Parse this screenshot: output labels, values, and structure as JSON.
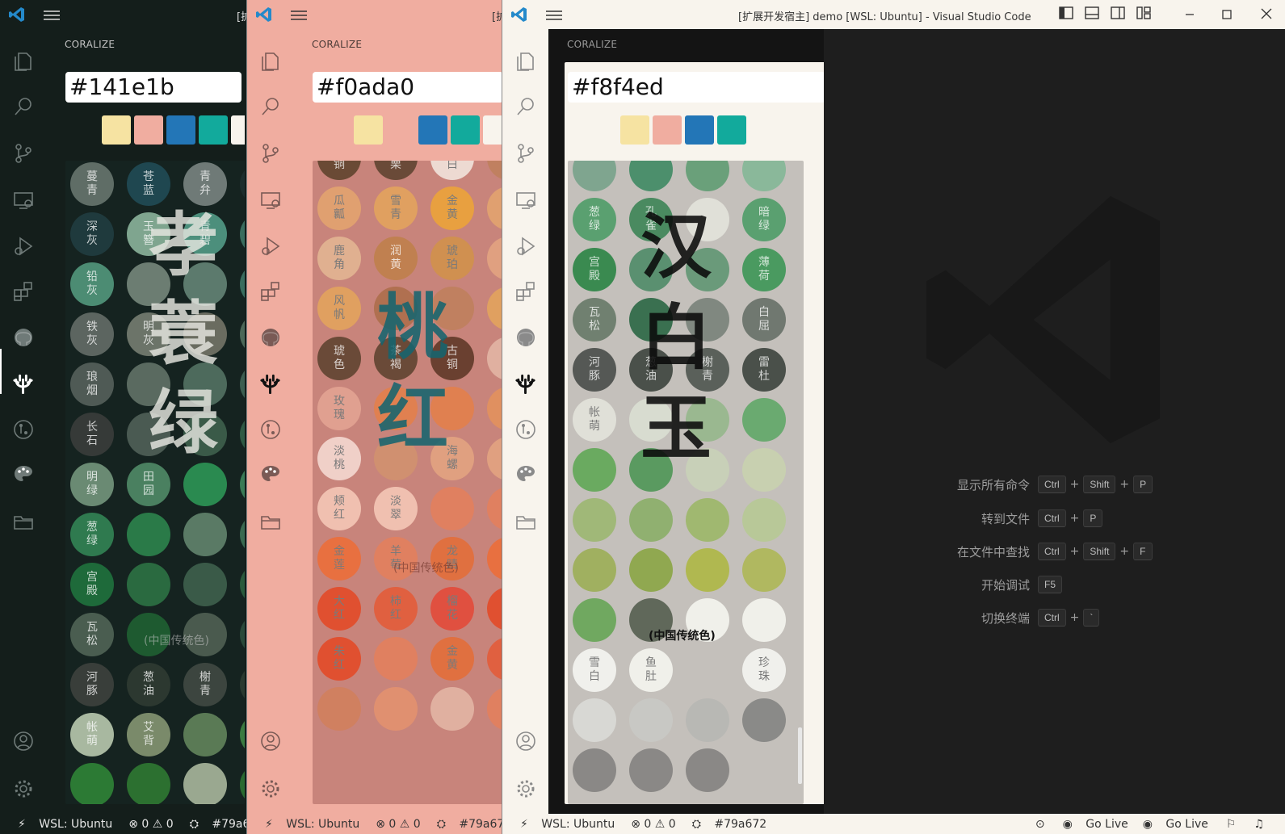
{
  "windows": [
    {
      "id": "w1",
      "title": "[扩",
      "sidebar_title": "CORALIZE",
      "hex": "#141e1b",
      "theme": {
        "titlebar": "#141e1b",
        "activity": "#141e1b",
        "sidebar": "#141e1b",
        "panel": "#141e1b",
        "text": "#ffffff",
        "header": "#c5c5c5",
        "grid": "#152320",
        "icon": "#6f7a78",
        "status": "#141e1b",
        "status_text": "#e6e6e6"
      },
      "swatches": [
        "#f6e3a2",
        "#f0ada0",
        "#2376b7",
        "#12aa9c",
        "#f8f4ed"
      ],
      "calli": "孝\n蓑\n绿",
      "calli_sub": "(中国传统色)",
      "dots": [
        {
          "l": "蔓\n青",
          "c": "#5f6d66"
        },
        {
          "l": "苍\n蓝",
          "c": "#1f4750"
        },
        {
          "l": "青\n弁",
          "c": "#6f7a77"
        },
        {
          "l": "",
          "c": "#1c2e2d"
        },
        {
          "l": "深\n灰",
          "c": "#1f3a3d"
        },
        {
          "l": "玉\n簪",
          "c": "#7fa58f"
        },
        {
          "l": "青\n碧",
          "c": "#4c8f7c"
        },
        {
          "l": "",
          "c": "#3a6d5e"
        },
        {
          "l": "铅\n灰",
          "c": "#4c8c73"
        },
        {
          "l": "",
          "c": "#6c7d72"
        },
        {
          "l": "",
          "c": "#5c7a6d"
        },
        {
          "l": "",
          "c": "#3a6d5e"
        },
        {
          "l": "铁\n灰",
          "c": "#5c6560"
        },
        {
          "l": "明\n灰",
          "c": "#6c7469"
        },
        {
          "l": "",
          "c": "#6a6c60"
        },
        {
          "l": "",
          "c": "#4c6858"
        },
        {
          "l": "琅\n烟",
          "c": "#4f5a55"
        },
        {
          "l": "",
          "c": "#5a6a60"
        },
        {
          "l": "",
          "c": "#4d6a5c"
        },
        {
          "l": "",
          "c": "#3c5e50"
        },
        {
          "l": "长\n石",
          "c": "#363a38"
        },
        {
          "l": "",
          "c": "#4a5a52"
        },
        {
          "l": "",
          "c": "#3a5a48"
        },
        {
          "l": "",
          "c": "#2f5a44"
        },
        {
          "l": "明\n绿",
          "c": "#6a8a73"
        },
        {
          "l": "田\n园",
          "c": "#4a8060"
        },
        {
          "l": "",
          "c": "#2a8a50"
        },
        {
          "l": "",
          "c": "#3a7a55"
        },
        {
          "l": "葱\n绿",
          "c": "#2f7a4f"
        },
        {
          "l": "",
          "c": "#2a7a48"
        },
        {
          "l": "",
          "c": "#5a7a65"
        },
        {
          "l": "",
          "c": "#3a6a50"
        },
        {
          "l": "宫\n殿",
          "c": "#1e6a3a"
        },
        {
          "l": "",
          "c": "#2a6a40"
        },
        {
          "l": "",
          "c": "#3a5a48"
        },
        {
          "l": "",
          "c": "#2a5a3c"
        },
        {
          "l": "瓦\n松",
          "c": "#4a5d50"
        },
        {
          "l": "",
          "c": "#1e5a30"
        },
        {
          "l": "",
          "c": "#4a5a4e"
        },
        {
          "l": "",
          "c": "#2a4a3a"
        },
        {
          "l": "河\n豚",
          "c": "#393e3a"
        },
        {
          "l": "葱\n油",
          "c": "#2c3830"
        },
        {
          "l": "榭\n青",
          "c": "#3c453f"
        },
        {
          "l": "",
          "c": "#2a3a30"
        },
        {
          "l": "帐\n萌",
          "c": "#a8b8a0"
        },
        {
          "l": "艾\n背",
          "c": "#7a8a6a"
        },
        {
          "l": "",
          "c": "#5a7a55"
        },
        {
          "l": "",
          "c": "#3a7a40"
        },
        {
          "l": "",
          "c": "#2c7a34"
        },
        {
          "l": "",
          "c": "#2c7030"
        },
        {
          "l": "",
          "c": "#9aa890"
        },
        {
          "l": "",
          "c": "#2a6a30"
        }
      ],
      "status": {
        "wsl": "WSL: Ubuntu",
        "problems": "⊗ 0 ⚠ 0",
        "branch": "#79a672"
      }
    },
    {
      "id": "w2",
      "title": "[扩",
      "sidebar_title": "CORALIZE",
      "hex": "#f0ada0",
      "theme": {
        "titlebar": "#f0ada0",
        "activity": "#f0ada0",
        "sidebar": "#f0ada0",
        "panel": "#f0ada0",
        "text": "#111111",
        "header": "#4a3a36",
        "grid": "#c8847b",
        "icon": "#7a5a55",
        "status": "#f0ada0",
        "status_text": "#333333"
      },
      "swatches": [
        "#f6e3a2",
        "#f0ada0",
        "#2376b7",
        "#12aa9c",
        "#f8f4ed"
      ],
      "calli": "桃\n红",
      "calli_sub": "(中国传统色)",
      "dots": [
        {
          "l": "古\n铜",
          "c": "#6a4a35"
        },
        {
          "l": "马\n栗",
          "c": "#6a4a38"
        },
        {
          "l": "粉\n白",
          "c": "#eddad2"
        },
        {
          "l": "",
          "c": "#c08060"
        },
        {
          "l": "瓜\n瓤",
          "c": "#e0a070"
        },
        {
          "l": "雪\n青",
          "c": "#e0a060"
        },
        {
          "l": "金\n黄",
          "c": "#e8a040"
        },
        {
          "l": "",
          "c": "#e0a070"
        },
        {
          "l": "鹿\n角",
          "c": "#e0b090"
        },
        {
          "l": "润\n黄",
          "c": "#c08050"
        },
        {
          "l": "琥\n珀",
          "c": "#d09050"
        },
        {
          "l": "",
          "c": "#e0a080"
        },
        {
          "l": "风\n帆",
          "c": "#e0a060"
        },
        {
          "l": "",
          "c": "#b07050"
        },
        {
          "l": "",
          "c": "#c08060"
        },
        {
          "l": "",
          "c": "#e0a060"
        },
        {
          "l": "琥\n色",
          "c": "#6a4a38"
        },
        {
          "l": "茶\n褐",
          "c": "#6a4a38"
        },
        {
          "l": "古\n铜",
          "c": "#6a4030"
        },
        {
          "l": "",
          "c": "#e0b0a0"
        },
        {
          "l": "玫\n瑰",
          "c": "#e0a090"
        },
        {
          "l": "",
          "c": "#e08050"
        },
        {
          "l": "",
          "c": "#e08050"
        },
        {
          "l": "",
          "c": "#e09060"
        },
        {
          "l": "淡\n桃",
          "c": "#f0d0c8"
        },
        {
          "l": "",
          "c": "#d09070"
        },
        {
          "l": "海\n螺",
          "c": "#e0a080"
        },
        {
          "l": "",
          "c": "#e0a080"
        },
        {
          "l": "颊\n红",
          "c": "#f0c0b0"
        },
        {
          "l": "淡\n翠",
          "c": "#f0c0b0"
        },
        {
          "l": "",
          "c": "#e08060"
        },
        {
          "l": "",
          "c": "#e08060"
        },
        {
          "l": "金\n莲",
          "c": "#e87040"
        },
        {
          "l": "羊\n莓",
          "c": "#e08060"
        },
        {
          "l": "龙\n睛",
          "c": "#e07040"
        },
        {
          "l": "",
          "c": "#e87040"
        },
        {
          "l": "大\n红",
          "c": "#e05030"
        },
        {
          "l": "柿\n红",
          "c": "#e06040"
        },
        {
          "l": "榴\n花",
          "c": "#e05040"
        },
        {
          "l": "",
          "c": "#e05030"
        },
        {
          "l": "朱\n红",
          "c": "#e05030"
        },
        {
          "l": "",
          "c": "#e08060"
        },
        {
          "l": "金\n黄",
          "c": "#e07040"
        },
        {
          "l": "",
          "c": "#e06040"
        },
        {
          "l": "",
          "c": "#d08060"
        },
        {
          "l": "",
          "c": "#e09070"
        },
        {
          "l": "",
          "c": "#e0b0a0"
        },
        {
          "l": "",
          "c": "#e08060"
        }
      ],
      "status": {
        "wsl": "WSL: Ubuntu",
        "problems": "⊗ 0 ⚠ 0",
        "branch": "#79a672"
      }
    },
    {
      "id": "w3",
      "title": "[扩展开发宿主] demo [WSL: Ubuntu] - Visual Studio Code",
      "sidebar_title": "CORALIZE",
      "hex": "#f8f4ed",
      "theme": {
        "titlebar": "#f8f4ed",
        "activity": "#f8f4ed",
        "sidebar": "#141414",
        "panel": "#f8f4ed",
        "text": "#111111",
        "header": "#9a9a9a",
        "grid": "#c4c0bb",
        "icon": "#8a8a8a",
        "status": "#f8f4ed",
        "status_text": "#333333"
      },
      "swatches": [
        "#f6e3a2",
        "#f0ada0",
        "#2376b7",
        "#12aa9c"
      ],
      "calli": "汉\n白\n玉",
      "calli_sub": "(中国传统色)",
      "dots": [
        {
          "l": "",
          "c": "#7fa58f"
        },
        {
          "l": "",
          "c": "#4c8f6c"
        },
        {
          "l": "",
          "c": "#6aa07a"
        },
        {
          "l": "",
          "c": "#8ab89a"
        },
        {
          "l": "葱\n绿",
          "c": "#5aa070"
        },
        {
          "l": "孔\n雀",
          "c": "#4a8a60"
        },
        {
          "l": "",
          "c": "#e0e0d8"
        },
        {
          "l": "暗\n绿",
          "c": "#5aa070"
        },
        {
          "l": "宫\n殿",
          "c": "#3a8a50"
        },
        {
          "l": "",
          "c": "#5a9070"
        },
        {
          "l": "",
          "c": "#6a9a7a"
        },
        {
          "l": "薄\n荷",
          "c": "#4a9a60"
        },
        {
          "l": "瓦\n松",
          "c": "#708070"
        },
        {
          "l": "",
          "c": "#3a7050"
        },
        {
          "l": "",
          "c": "#808880"
        },
        {
          "l": "白\n屈",
          "c": "#707870"
        },
        {
          "l": "河\n豚",
          "c": "#555855"
        },
        {
          "l": "葱\n油",
          "c": "#4a504a"
        },
        {
          "l": "榭\n青",
          "c": "#5a605a"
        },
        {
          "l": "雷\n杜",
          "c": "#4a504a"
        },
        {
          "l": "帐\n萌",
          "c": "#e0e0d8"
        },
        {
          "l": "",
          "c": "#d8dcd0"
        },
        {
          "l": "",
          "c": "#9ab890"
        },
        {
          "l": "",
          "c": "#6aaa70"
        },
        {
          "l": "",
          "c": "#6aaa60"
        },
        {
          "l": "",
          "c": "#5a9a60"
        },
        {
          "l": "",
          "c": "#c8d0b8"
        },
        {
          "l": "",
          "c": "#c8d0b0"
        },
        {
          "l": "",
          "c": "#a0b878"
        },
        {
          "l": "",
          "c": "#90b070"
        },
        {
          "l": "",
          "c": "#a0b870"
        },
        {
          "l": "",
          "c": "#b8c898"
        },
        {
          "l": "",
          "c": "#a0b060"
        },
        {
          "l": "",
          "c": "#90a850"
        },
        {
          "l": "",
          "c": "#b0b850"
        },
        {
          "l": "",
          "c": "#b0b860"
        },
        {
          "l": "",
          "c": "#70a860"
        },
        {
          "l": "",
          "c": "#60685a"
        },
        {
          "l": "",
          "c": "#f0f0ea"
        },
        {
          "l": "",
          "c": "#f0f0ea"
        },
        {
          "l": "雪\n白",
          "c": "#f0f0ec"
        },
        {
          "l": "鱼\n肚",
          "c": "#f0f0ea"
        },
        {
          "l": "",
          "c": "#c4c0bb"
        },
        {
          "l": "珍\n珠",
          "c": "#f0f0ec"
        },
        {
          "l": "",
          "c": "#d8d8d4"
        },
        {
          "l": "",
          "c": "#c8c8c4"
        },
        {
          "l": "",
          "c": "#b8b8b4"
        },
        {
          "l": "",
          "c": "#8a8a88"
        },
        {
          "l": "",
          "c": "#8a8886"
        },
        {
          "l": "",
          "c": "#8a8886"
        },
        {
          "l": "",
          "c": "#8a8886"
        },
        {
          "l": "",
          "c": "#c4c0bb"
        }
      ],
      "status": {
        "wsl": "WSL: Ubuntu",
        "problems": "⊗ 0 ⚠ 0",
        "branch": "#79a672",
        "golive1": "Go Live",
        "golive2": "Go Live"
      }
    }
  ],
  "editor": {
    "shortcuts": [
      {
        "label": "显示所有命令",
        "keys": [
          "Ctrl",
          "Shift",
          "P"
        ]
      },
      {
        "label": "转到文件",
        "keys": [
          "Ctrl",
          "P"
        ]
      },
      {
        "label": "在文件中查找",
        "keys": [
          "Ctrl",
          "Shift",
          "F"
        ]
      },
      {
        "label": "开始调试",
        "keys": [
          "F5"
        ]
      },
      {
        "label": "切换终端",
        "keys": [
          "Ctrl",
          "`"
        ]
      }
    ]
  },
  "icons": [
    "vscode-logo-icon",
    "menu-icon",
    "explorer-icon",
    "search-icon",
    "source-control-icon",
    "remote-explorer-icon",
    "run-debug-icon",
    "extensions-icon",
    "github-icon",
    "coralize-icon",
    "git-graph-icon",
    "palette-icon",
    "folder-icon",
    "account-icon",
    "settings-gear-icon"
  ]
}
